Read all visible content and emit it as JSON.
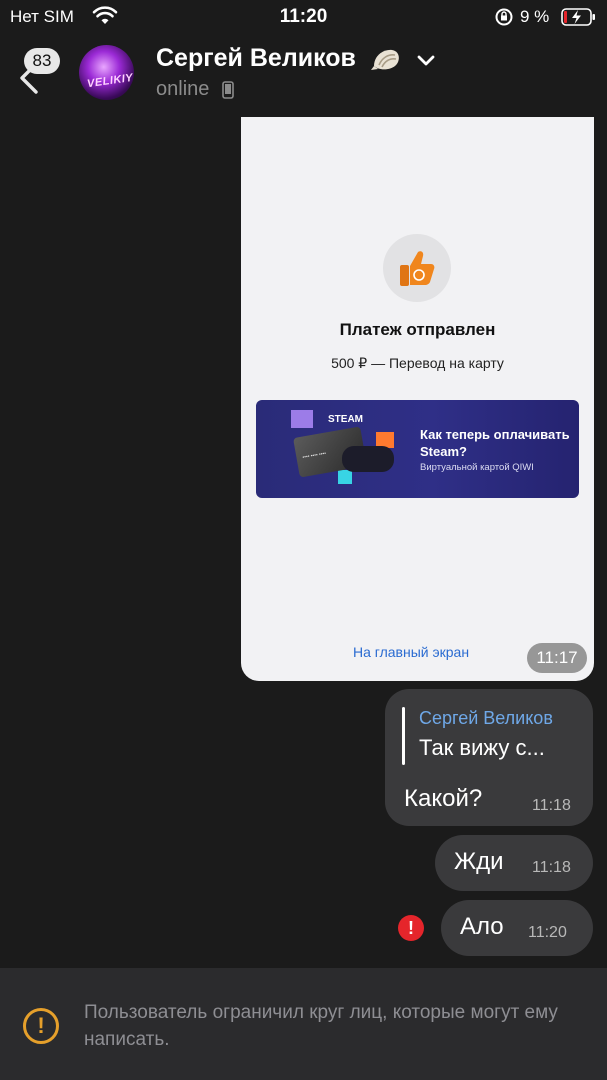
{
  "status_bar": {
    "carrier": "Нет SIM",
    "time": "11:20",
    "battery_percent": "9 %"
  },
  "header": {
    "back_badge": "83",
    "avatar_text": "VELIKIY",
    "contact_name": "Сергей Великов",
    "name_emoji": "🐚",
    "presence": "online",
    "presence_icon": "phone-icon"
  },
  "messages": {
    "image": {
      "title": "Платеж отправлен",
      "subtitle": "500 ₽ — Перевод на карту",
      "banner_brand": "STEAM",
      "banner_title": "Как теперь оплачивать Steam?",
      "banner_sub": "Виртуальной картой QIWI",
      "home_link": "На главный экран",
      "time": "11:17"
    },
    "reply_msg": {
      "reply_name": "Сергей Великов",
      "reply_text": "Так вижу с...",
      "text": "Какой?",
      "time": "11:18"
    },
    "msg2": {
      "text": "Жди",
      "time": "11:18"
    },
    "msg3": {
      "text": "Ало",
      "time": "11:20",
      "status": "failed"
    }
  },
  "notice": {
    "text": "Пользователь ограничил круг лиц, которые могут ему написать."
  },
  "colors": {
    "background": "#1b1b1b",
    "bubble": "#3a3a3c",
    "accent_link": "#6fa8e8",
    "error": "#e5252b",
    "warning": "#e6a02b"
  }
}
